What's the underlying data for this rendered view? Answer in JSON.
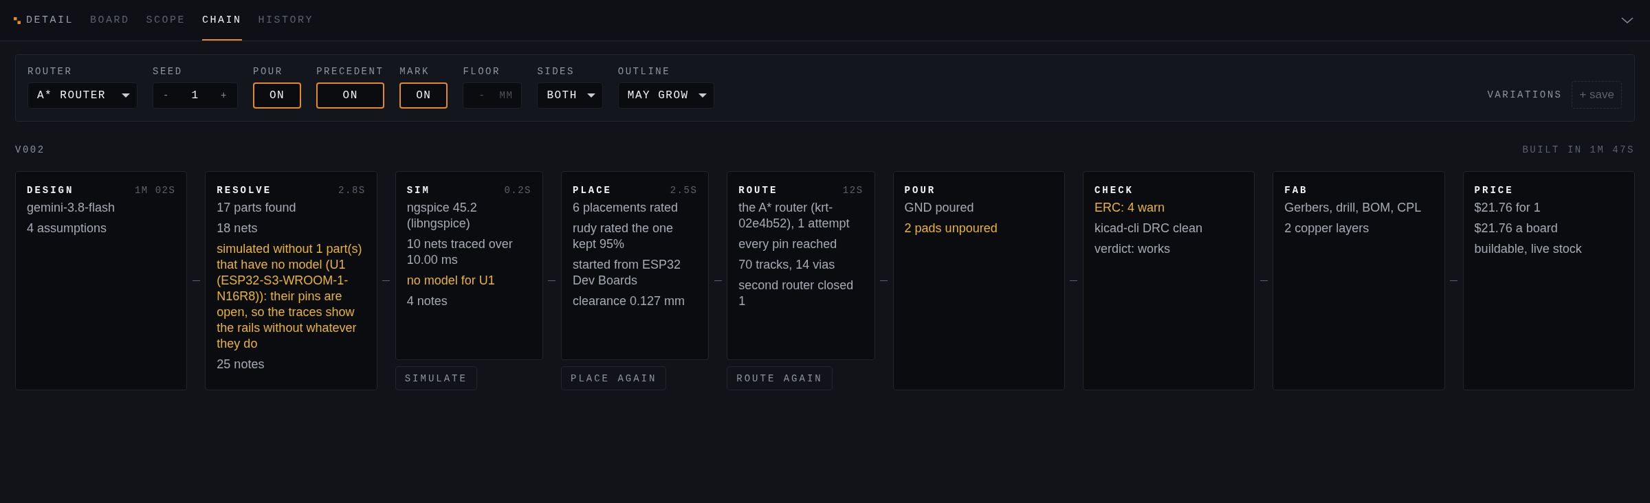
{
  "tabs": [
    {
      "label": "DETAIL",
      "selected": false,
      "logo": true
    },
    {
      "label": "BOARD",
      "selected": false
    },
    {
      "label": "SCOPE",
      "selected": false
    },
    {
      "label": "CHAIN",
      "selected": true
    },
    {
      "label": "HISTORY",
      "selected": false
    }
  ],
  "controls": [
    {
      "kind": "select",
      "label": "ROUTER",
      "value": "A* ROUTER"
    },
    {
      "kind": "stepper",
      "label": "SEED",
      "minus": "-",
      "value": "1",
      "plus": "+"
    },
    {
      "kind": "toggle",
      "label": "POUR",
      "value": "ON",
      "on": true
    },
    {
      "kind": "toggle",
      "label": "PRECEDENT",
      "value": "ON",
      "on": true
    },
    {
      "kind": "toggle",
      "label": "MARK",
      "value": "ON",
      "on": true
    },
    {
      "kind": "unit",
      "label": "FLOOR",
      "placeholder": "-",
      "unit": "MM"
    },
    {
      "kind": "select",
      "label": "SIDES",
      "value": "BOTH"
    },
    {
      "kind": "select",
      "label": "OUTLINE",
      "value": "MAY GROW"
    }
  ],
  "variations": {
    "label": "VARIATIONS",
    "button": "+ save"
  },
  "version": "V002",
  "built": "BUILT IN 1M 47S",
  "stages": [
    {
      "title": "DESIGN",
      "time": "1M 02S",
      "lines": [
        {
          "text": "gemini-3.8-flash",
          "kind": "plain"
        },
        {
          "text": "4 assumptions",
          "kind": "plain"
        }
      ]
    },
    {
      "title": "RESOLVE",
      "time": "2.8S",
      "lines": [
        {
          "text": "17 parts found",
          "kind": "plain"
        },
        {
          "text": "18 nets",
          "kind": "plain"
        },
        {
          "text": "simulated without 1 part(s) that have no model (U1 (ESP32-S3-WROOM-1-N16R8)): their pins are open, so the traces show the rails without whatever they do",
          "kind": "warn"
        },
        {
          "text": "25 notes",
          "kind": "plain"
        }
      ]
    },
    {
      "title": "SIM",
      "time": "0.2S",
      "lines": [
        {
          "text": "ngspice 45.2 (libngspice)",
          "kind": "plain"
        },
        {
          "text": "10 nets traced over 10.00 ms",
          "kind": "plain"
        },
        {
          "text": "no model for U1",
          "kind": "warn"
        },
        {
          "text": "4 notes",
          "kind": "plain"
        }
      ],
      "action": "SIMULATE"
    },
    {
      "title": "PLACE",
      "time": "2.5S",
      "lines": [
        {
          "text": "6 placements rated",
          "kind": "plain"
        },
        {
          "text": "rudy rated the one kept 95%",
          "kind": "plain"
        },
        {
          "text": "started from ESP32 Dev Boards",
          "kind": "plain"
        },
        {
          "text": "clearance 0.127 mm",
          "kind": "plain"
        }
      ],
      "action": "PLACE AGAIN"
    },
    {
      "title": "ROUTE",
      "time": "12S",
      "lines": [
        {
          "text": "the A* router (krt-02e4b52), 1 attempt",
          "kind": "plain"
        },
        {
          "text": "every pin reached",
          "kind": "plain"
        },
        {
          "text": "70 tracks, 14 vias",
          "kind": "plain"
        },
        {
          "text": "second router closed 1",
          "kind": "plain"
        }
      ],
      "action": "ROUTE AGAIN"
    },
    {
      "title": "POUR",
      "lines": [
        {
          "text": "GND poured",
          "kind": "plain"
        },
        {
          "text": "2 pads unpoured",
          "kind": "warn"
        }
      ]
    },
    {
      "title": "CHECK",
      "lines": [
        {
          "text": "ERC: 4 warn",
          "kind": "warn"
        },
        {
          "text": "kicad-cli DRC clean",
          "kind": "plain"
        },
        {
          "text": "verdict: works",
          "kind": "plain"
        }
      ]
    },
    {
      "title": "FAB",
      "lines": [
        {
          "text": "Gerbers, drill, BOM, CPL",
          "kind": "plain"
        },
        {
          "text": "2 copper layers",
          "kind": "plain"
        }
      ]
    },
    {
      "title": "PRICE",
      "lines": [
        {
          "text": "$21.76 for 1",
          "kind": "plain"
        },
        {
          "text": "$21.76 a board",
          "kind": "plain"
        },
        {
          "text": "buildable, live stock",
          "kind": "plain"
        }
      ]
    }
  ]
}
